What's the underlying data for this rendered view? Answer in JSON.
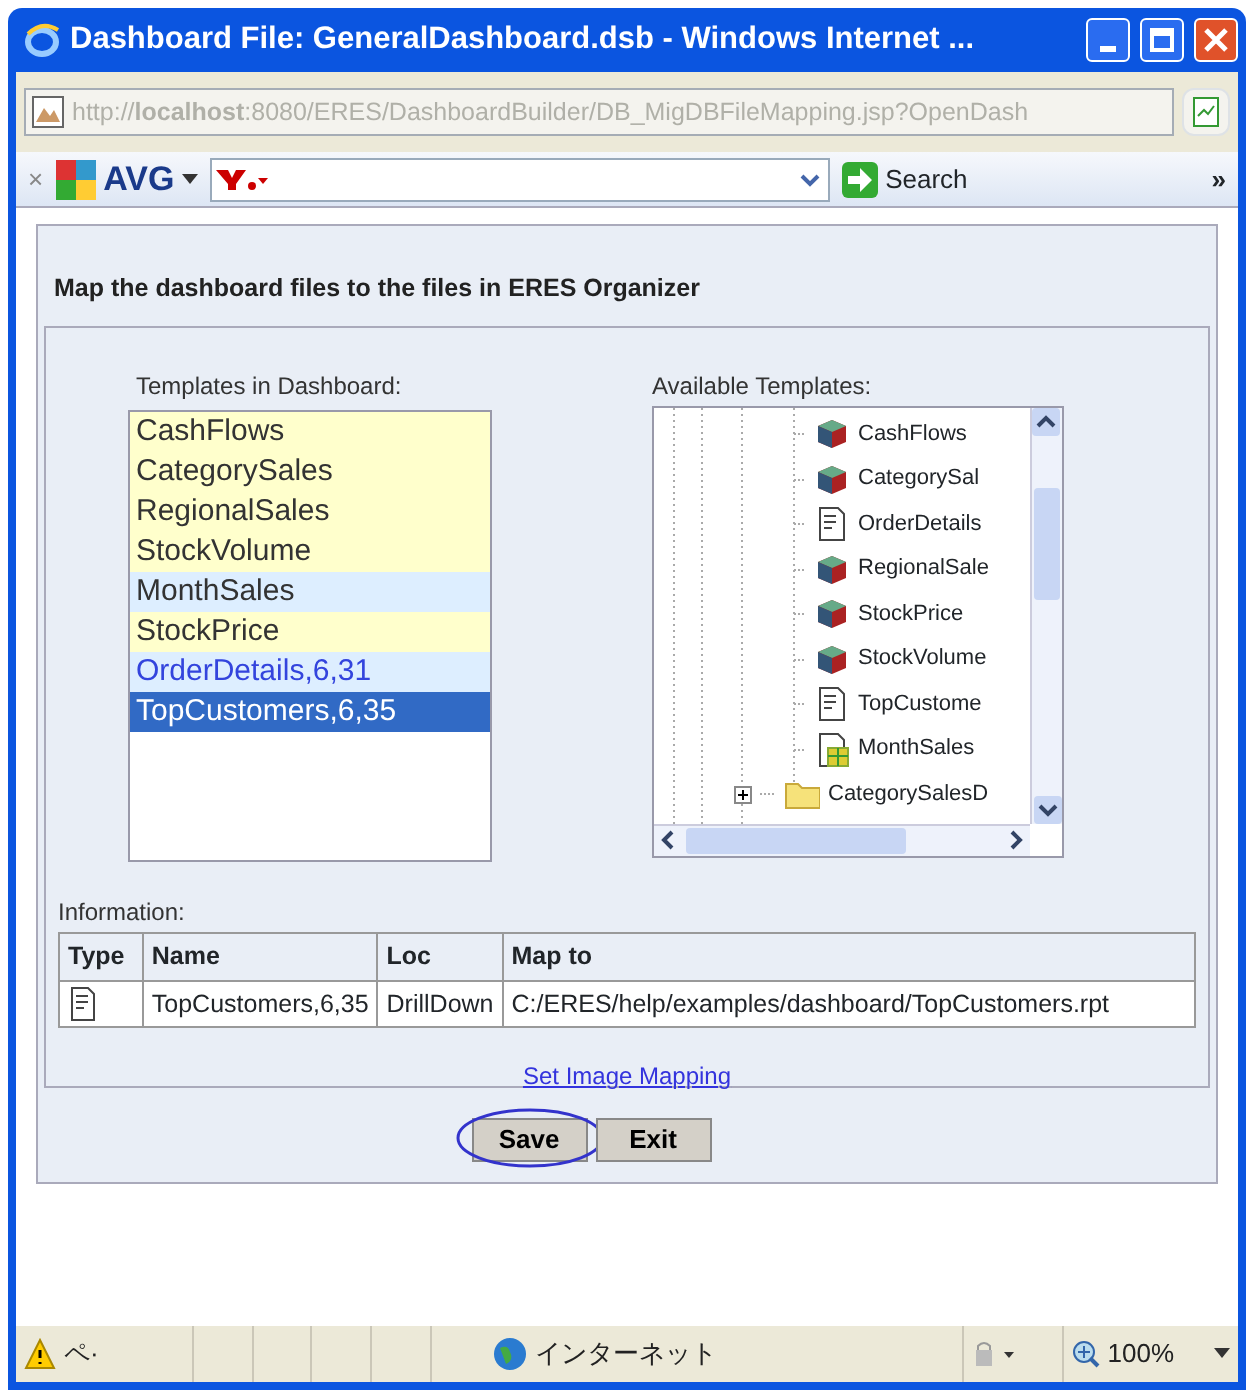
{
  "window": {
    "title": "Dashboard File: GeneralDashboard.dsb - Windows Internet ..."
  },
  "address": {
    "url": "http://**localhost**:8080/ERES/DashboardBuilder/DB_MigDBFileMapping.jsp?OpenDash"
  },
  "toolbar": {
    "close": "×",
    "brand": "AVG",
    "search": "Search",
    "more": "»"
  },
  "heading": "Map the dashboard files to the files in ERES Organizer",
  "templates": {
    "label": "Templates in Dashboard:",
    "items": [
      {
        "label": "CashFlows",
        "kind": "report",
        "color": "#ffffcc",
        "selected": false
      },
      {
        "label": "CategorySales",
        "kind": "report",
        "color": "#ffffcc",
        "selected": false
      },
      {
        "label": "RegionalSales",
        "kind": "report",
        "color": "#ffffcc",
        "selected": false
      },
      {
        "label": "StockVolume",
        "kind": "report",
        "color": "#ffffcc",
        "selected": false
      },
      {
        "label": "MonthSales",
        "kind": "report",
        "color": "#ddeeff",
        "selected": false
      },
      {
        "label": "StockPrice",
        "kind": "report",
        "color": "#ffffcc",
        "selected": false
      },
      {
        "label": "OrderDetails,6,31",
        "kind": "drilldown",
        "color": "#ddeeff",
        "selected": false
      },
      {
        "label": "TopCustomers,6,35",
        "selected": true
      }
    ]
  },
  "available": {
    "label": "Available Templates:",
    "items": [
      {
        "label": "CashFlows",
        "kind": "cube"
      },
      {
        "label": "CategorySal",
        "kind": "cube"
      },
      {
        "label": "OrderDetails",
        "kind": "report"
      },
      {
        "label": "RegionalSale",
        "kind": "cube"
      },
      {
        "label": "StockPrice",
        "kind": "cube"
      },
      {
        "label": "StockVolume",
        "kind": "cube"
      },
      {
        "label": "TopCustome",
        "kind": "report"
      },
      {
        "label": "MonthSales",
        "kind": "chart"
      },
      {
        "label": "CategorySalesD",
        "kind": "folder",
        "expanded": false
      }
    ]
  },
  "information": {
    "label": "Information:",
    "columns": [
      "Type",
      "Name",
      "Loc",
      "Map to"
    ],
    "rows": [
      {
        "name": "TopCustomers,6,35",
        "loc": "DrillDown",
        "map_to": "C:/ERES/help/examples/dashboard/TopCustomers.rpt"
      }
    ]
  },
  "link": "Set Image Mapping",
  "buttons": [
    {
      "label": "Save",
      "highlighted": true
    },
    {
      "label": "Exit",
      "highlighted": false
    }
  ],
  "status_bar": {
    "page": "ペ·",
    "zone": "インターネット",
    "zoom": "100%"
  }
}
